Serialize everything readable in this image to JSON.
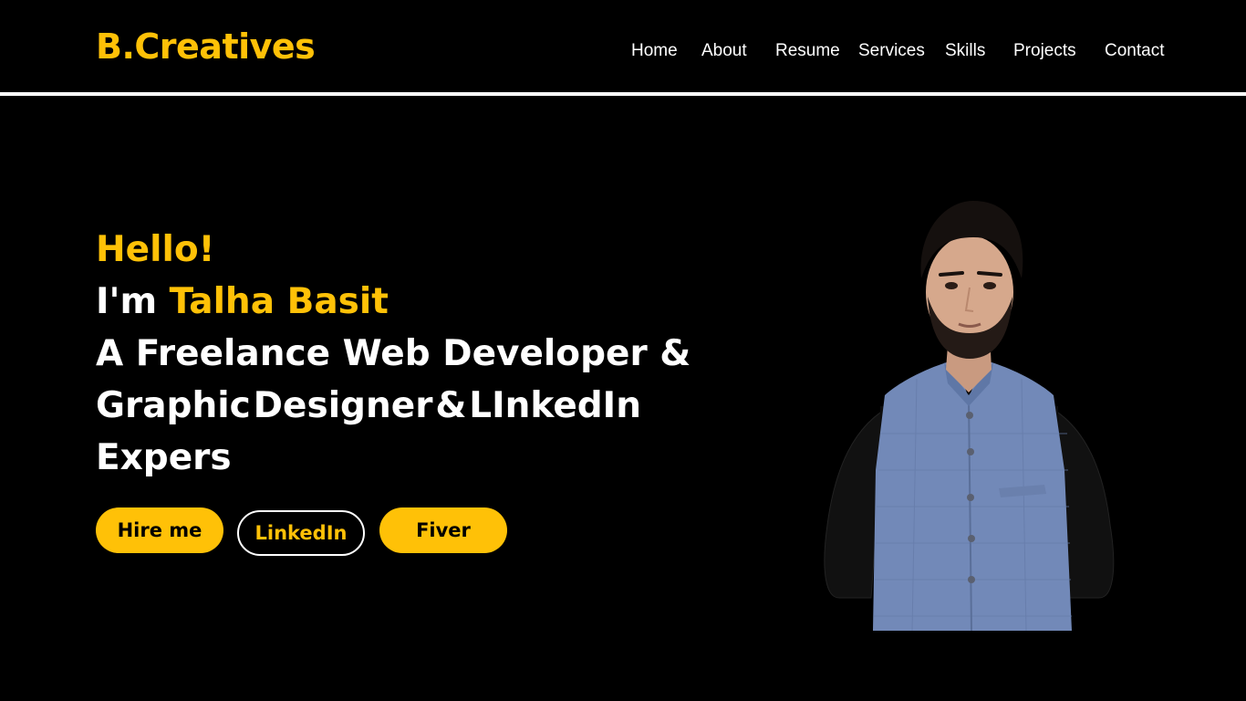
{
  "header": {
    "brand": "B.Creatives",
    "nav": [
      "Home",
      "About",
      "Resume",
      "Services",
      "Skills",
      "Projects",
      "Contact"
    ]
  },
  "hero": {
    "greeting": "Hello!",
    "intro_prefix": "I'm ",
    "name": "Talha Basit",
    "tagline_line1": "A Freelance Web Developer &",
    "tagline_line2_words": [
      "Graphic",
      "Designer",
      "&",
      "LInkedIn"
    ],
    "tagline_line3": "Expers"
  },
  "buttons": {
    "hire": "Hire me",
    "linkedin": "LinkedIn",
    "fiver": "Fiver"
  },
  "colors": {
    "accent": "#FFC107",
    "background": "#000000",
    "text": "#FFFFFF"
  }
}
